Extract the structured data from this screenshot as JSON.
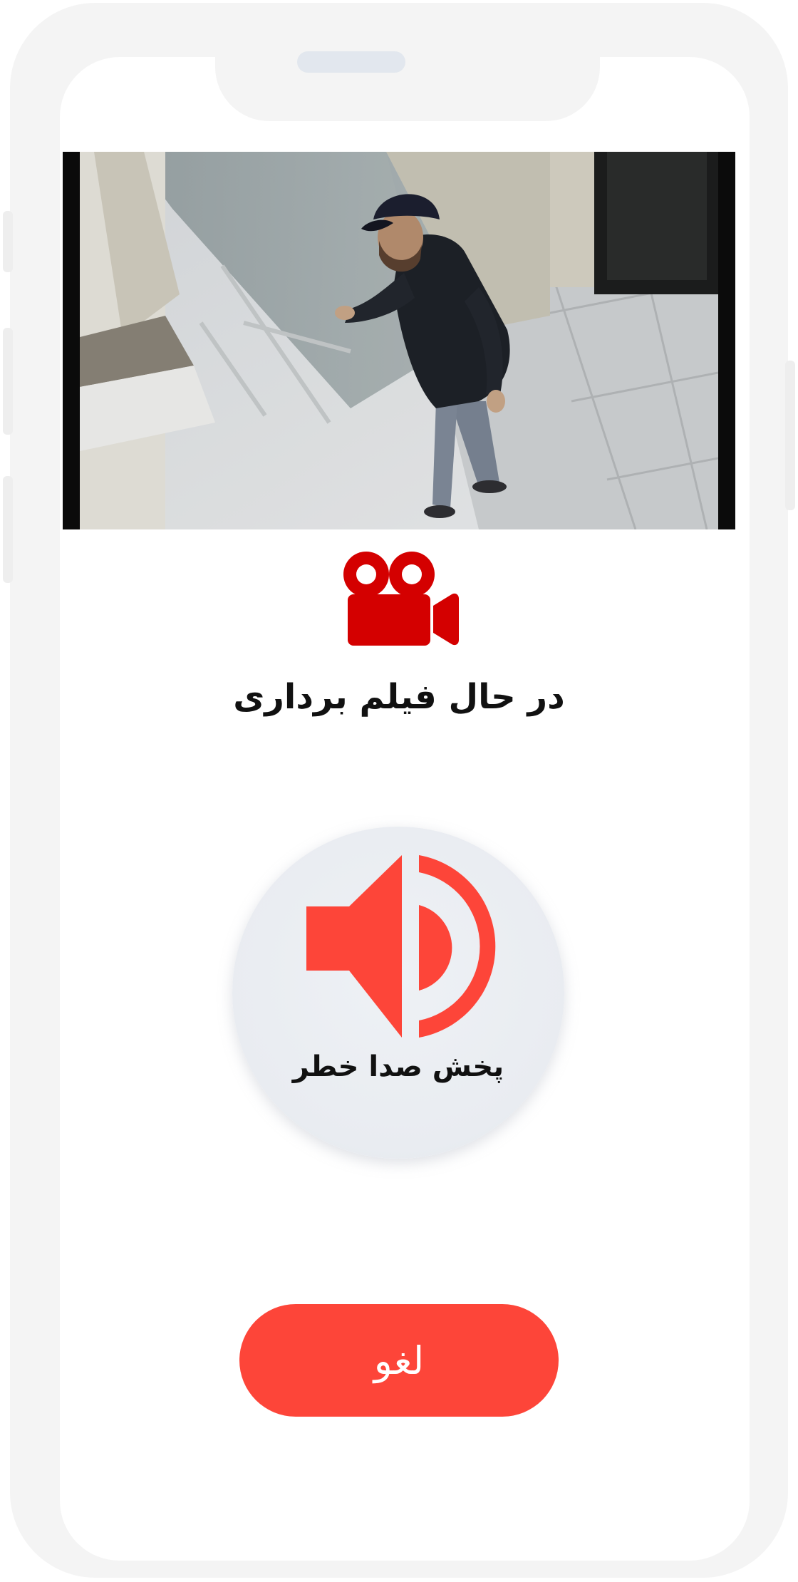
{
  "camera": {
    "status_text": "در حال فیلم برداری",
    "icon": "video-camera-icon"
  },
  "alarm": {
    "label": "پخش صدا خطر",
    "icon": "speaker-volume-icon"
  },
  "actions": {
    "cancel_label": "لغو"
  },
  "colors": {
    "accent_red": "#fd4539",
    "camera_icon_red": "#d40000",
    "button_surface": "#eceff3",
    "frame": "#f4f4f4"
  }
}
